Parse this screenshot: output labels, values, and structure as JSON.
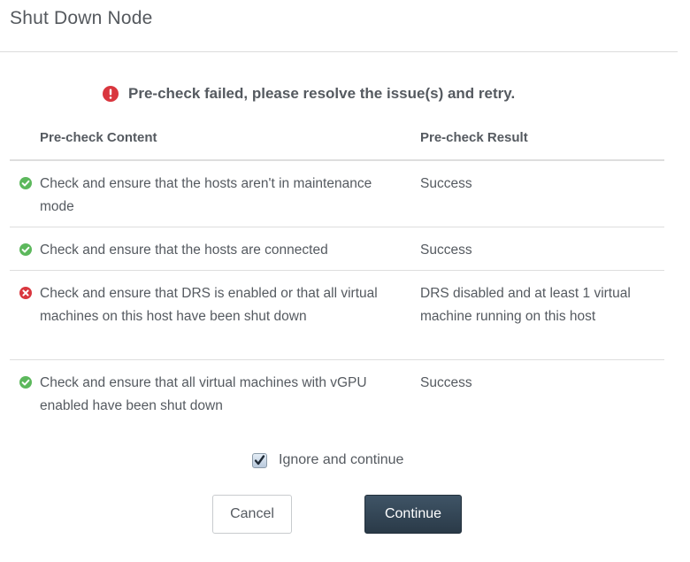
{
  "dialog": {
    "title": "Shut Down Node",
    "alert_text": "Pre-check failed, please resolve the issue(s) and retry."
  },
  "table": {
    "headers": [
      "Pre-check Content",
      "Pre-check Result"
    ],
    "rows": [
      {
        "status": "success",
        "content": "Check and ensure that the hosts aren't in maintenance mode",
        "result": "Success"
      },
      {
        "status": "success",
        "content": "Check and ensure that the hosts are connected",
        "result": "Success"
      },
      {
        "status": "error",
        "content": "Check and ensure that DRS is enabled or that all virtual machines on this host have been shut down",
        "result": "DRS disabled and at least 1 virtual machine running on this host"
      },
      {
        "status": "success",
        "content": "Check and ensure that all virtual machines with vGPU enabled have been shut down",
        "result": "Success"
      }
    ]
  },
  "ignore": {
    "label": "Ignore and continue",
    "checked": true
  },
  "buttons": {
    "cancel": "Cancel",
    "continue": "Continue"
  },
  "colors": {
    "success": "#5cb85c",
    "error": "#d9363e",
    "primary_button": "#33475a"
  },
  "icons": {
    "alert": "exclamation-circle-icon",
    "success": "check-circle-icon",
    "error": "x-circle-icon",
    "checkbox": "checkmark-icon"
  }
}
